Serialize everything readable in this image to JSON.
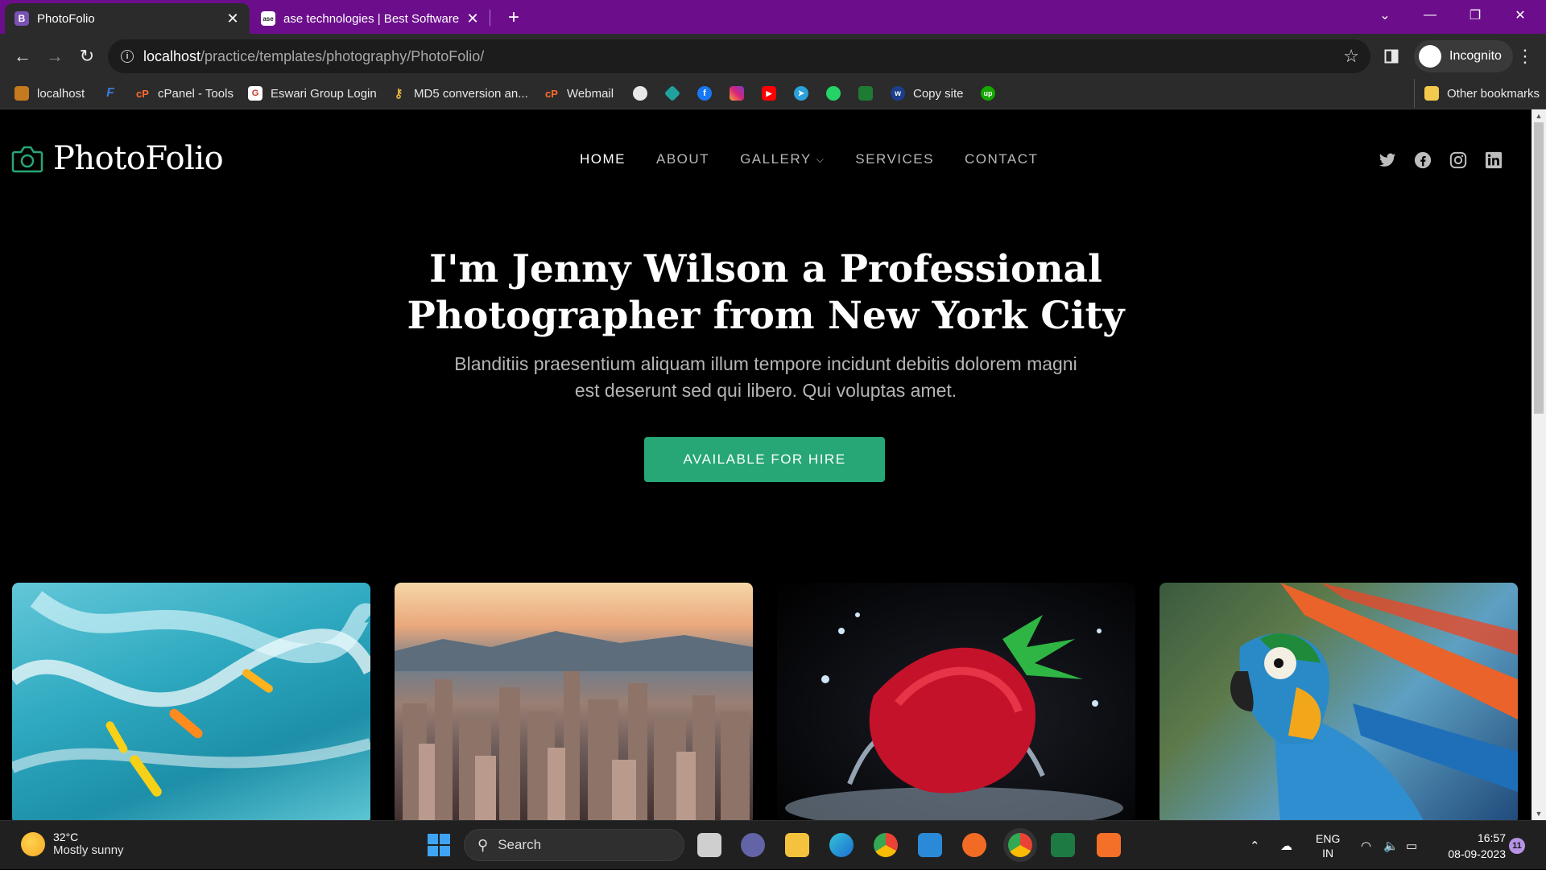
{
  "browser": {
    "tabs": [
      {
        "title": "PhotoFolio",
        "favicon_letter": "B",
        "active": true
      },
      {
        "title": "ase technologies | Best Software",
        "favicon_letter": "ase",
        "active": false
      }
    ],
    "new_tab_icon": "plus-icon",
    "address": {
      "host": "localhost",
      "path": "/practice/templates/photography/PhotoFolio/"
    },
    "profile_label": "Incognito",
    "bookmarks": [
      {
        "label": "localhost",
        "icon": "localhost-icon"
      },
      {
        "label": "",
        "icon": "f-icon"
      },
      {
        "label": "cPanel - Tools",
        "icon": "cpanel-icon"
      },
      {
        "label": "Eswari Group Login",
        "icon": "g-icon"
      },
      {
        "label": "MD5 conversion an...",
        "icon": "key-icon"
      },
      {
        "label": "Webmail",
        "icon": "cpanel-icon"
      },
      {
        "label": "",
        "icon": "github-icon"
      },
      {
        "label": "",
        "icon": "diamond-icon"
      },
      {
        "label": "",
        "icon": "facebook-icon"
      },
      {
        "label": "",
        "icon": "instagram-icon"
      },
      {
        "label": "",
        "icon": "youtube-icon"
      },
      {
        "label": "",
        "icon": "telegram-icon"
      },
      {
        "label": "",
        "icon": "whatsapp-icon"
      },
      {
        "label": "",
        "icon": "bookmark-green-icon"
      },
      {
        "label": "Copy site",
        "icon": "w-icon"
      },
      {
        "label": "",
        "icon": "upwork-icon"
      }
    ],
    "other_bookmarks": "Other bookmarks"
  },
  "site": {
    "brand": "PhotoFolio",
    "nav": [
      {
        "label": "HOME",
        "active": true
      },
      {
        "label": "ABOUT",
        "active": false
      },
      {
        "label": "GALLERY",
        "active": false,
        "dropdown": true
      },
      {
        "label": "SERVICES",
        "active": false
      },
      {
        "label": "CONTACT",
        "active": false
      }
    ],
    "social": [
      "twitter-icon",
      "facebook-icon",
      "instagram-icon",
      "linkedin-icon"
    ],
    "hero": {
      "prefix": "I'm",
      "name": "Jenny Wilson",
      "line1_suffix": "a Professional",
      "line2": "Photographer from New York City",
      "subtitle": "Blanditiis praesentium aliquam illum tempore incidunt debitis dolorem magni est deserunt sed qui libero. Qui voluptas amet.",
      "cta": "AVAILABLE FOR HIRE"
    },
    "gallery": [
      "surfers-photo",
      "city-skyline-photo",
      "strawberry-splash-photo",
      "macaw-parrot-photo"
    ],
    "accent": "#27a776"
  },
  "taskbar": {
    "weather": {
      "temp": "32°C",
      "desc": "Mostly sunny"
    },
    "search_label": "Search",
    "lang": "ENG",
    "region": "IN",
    "time": "16:57",
    "date": "08-09-2023",
    "notifications": "11"
  }
}
